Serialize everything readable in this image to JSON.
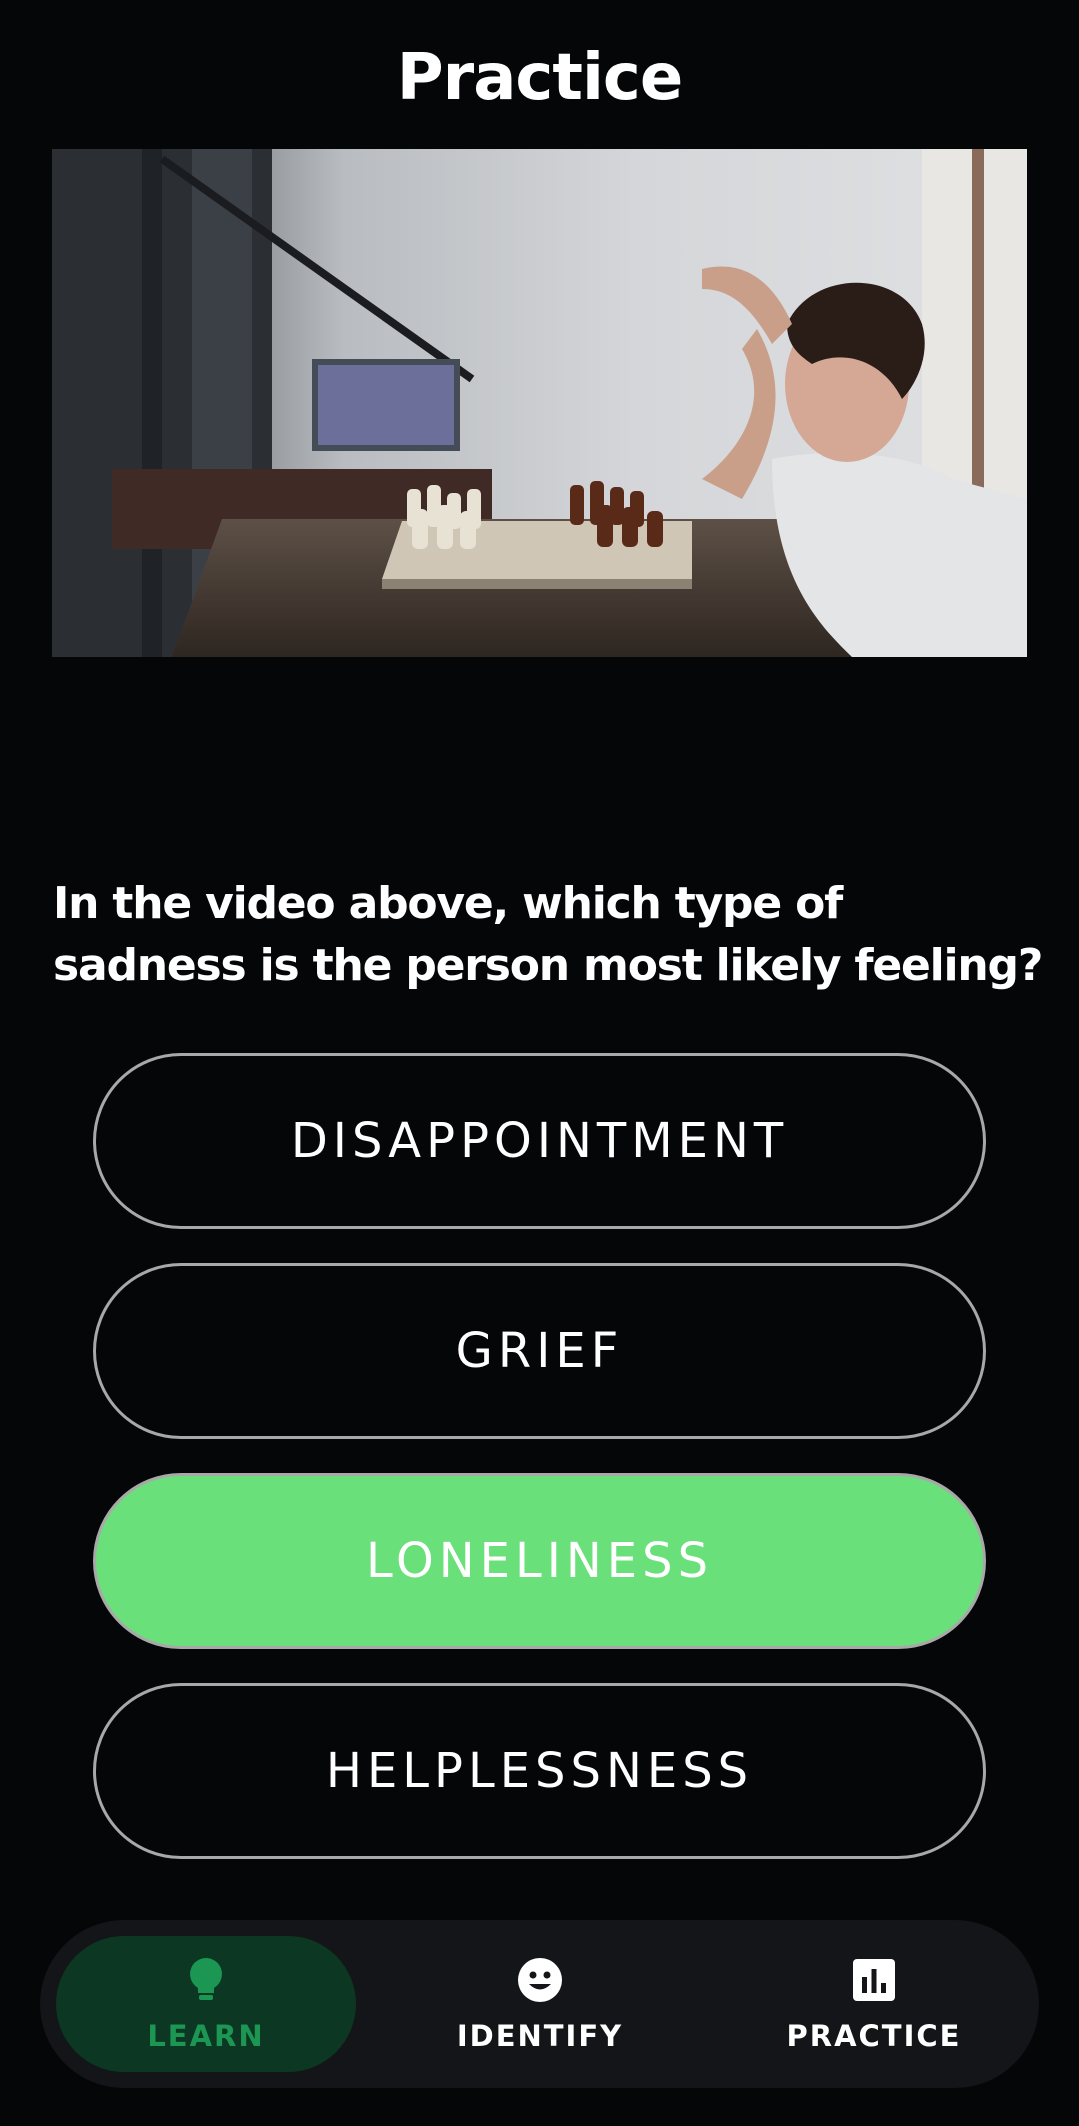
{
  "header": {
    "title": "Practice"
  },
  "video": {
    "content": "thumbnail-image"
  },
  "quiz": {
    "question": "In the video above, which type of sadness is the person most likely feeling?",
    "options": [
      {
        "label": "DISAPPOINTMENT",
        "selected": false
      },
      {
        "label": "GRIEF",
        "selected": false
      },
      {
        "label": "LONELINESS",
        "selected": true
      },
      {
        "label": "HELPLESSNESS",
        "selected": false
      }
    ],
    "selected_color": "#6ae07a"
  },
  "bottom_nav": {
    "items": [
      {
        "label": "LEARN",
        "icon": "lightbulb-icon",
        "active": true
      },
      {
        "label": "IDENTIFY",
        "icon": "smiley-face-icon",
        "active": false
      },
      {
        "label": "PRACTICE",
        "icon": "bar-chart-icon",
        "active": false
      }
    ],
    "active_color": "#1c9653",
    "active_bg": "#0c3722"
  }
}
